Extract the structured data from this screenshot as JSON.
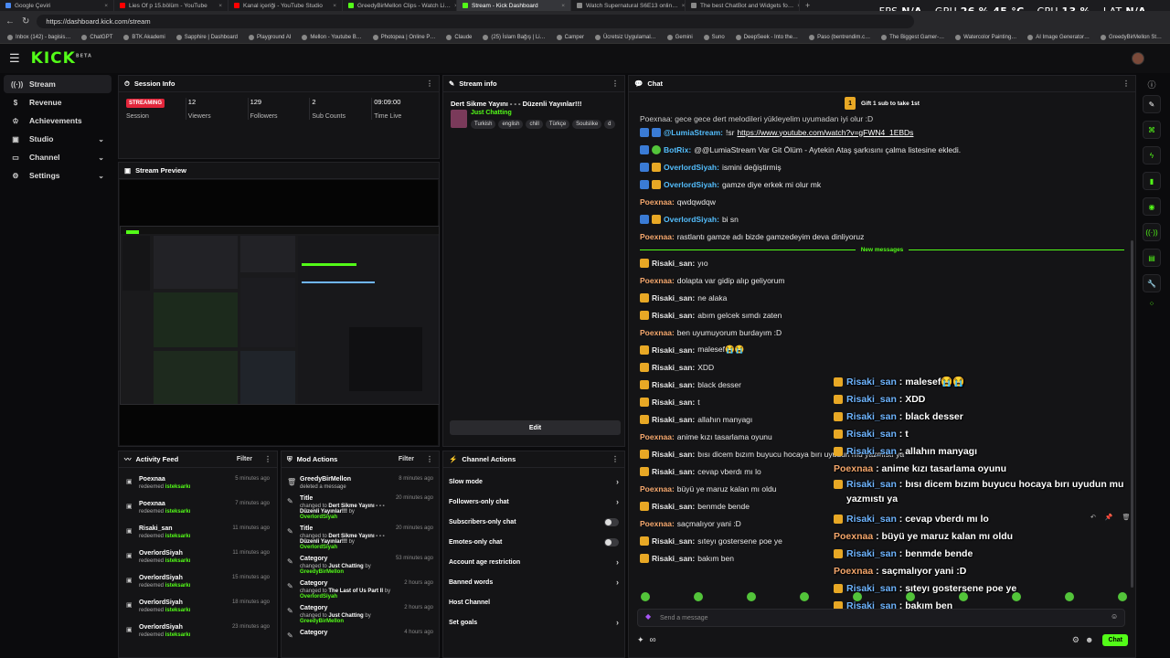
{
  "browser": {
    "tabs": [
      {
        "title": "Google Çeviri",
        "color": "#4a8af4"
      },
      {
        "title": "Lies Of p 15.bölüm - YouTube",
        "color": "#ff0000"
      },
      {
        "title": "Kanal içeriği - YouTube Studio",
        "color": "#ff0000"
      },
      {
        "title": "GreedyBirMellon Clips - Watch Li…",
        "color": "#53fc18"
      },
      {
        "title": "Stream - Kick Dashboard",
        "color": "#53fc18",
        "active": true
      },
      {
        "title": "Watch Supernatural S6E13 onlin…",
        "color": "#888888"
      },
      {
        "title": "The best ChatBot and Widgets fo…",
        "color": "#888888"
      }
    ],
    "url": "https://dashboard.kick.com/stream",
    "bookmarks": [
      "Inbox (142) - bagisis…",
      "ChatGPT",
      "BTK Akademi",
      "Sapphire | Dashboard",
      "Playground AI",
      "Mellon - Youtube B…",
      "Photopea | Online P…",
      "Claude",
      "(25) İslam Bağış | Li…",
      "Camper",
      "Ücretsiz Uygulamal…",
      "Gemini",
      "Suno",
      "DeepSeek - Into the…",
      "Paso (bentrendim.c…",
      "The Biggest Gamer-…",
      "Watercolor Painting…",
      "AI Image Generator…",
      "GreedyBirMellon St…"
    ]
  },
  "perf": {
    "fps_label": "FPS",
    "fps": "N/A",
    "gpu_label": "GPU",
    "gpu": "26 % 45 °C",
    "cpu_label": "CPU",
    "cpu": "13 %",
    "lat_label": "LAT",
    "lat": "N/A"
  },
  "sidebar": {
    "items": [
      {
        "label": "Stream",
        "icon": "broadcast-icon",
        "active": true
      },
      {
        "label": "Revenue",
        "icon": "dollar-icon"
      },
      {
        "label": "Achievements",
        "icon": "trophy-icon"
      },
      {
        "label": "Studio",
        "icon": "camera-icon",
        "expandable": true
      },
      {
        "label": "Channel",
        "icon": "channel-icon",
        "expandable": true
      },
      {
        "label": "Settings",
        "icon": "gear-icon",
        "expandable": true
      }
    ]
  },
  "session": {
    "title": "Session Info",
    "status": "STREAMING",
    "stats": [
      {
        "value": "",
        "label": "Session"
      },
      {
        "value": "12",
        "label": "Viewers"
      },
      {
        "value": "129",
        "label": "Followers"
      },
      {
        "value": "2",
        "label": "Sub Counts"
      },
      {
        "value": "09:09:00",
        "label": "Time Live"
      }
    ]
  },
  "preview": {
    "title": "Stream Preview"
  },
  "stream_info": {
    "title": "Stream info",
    "stream_title": "Dert Sikme Yayını - - - Düzenli Yayınlar!!!",
    "category": "Just Chatting",
    "tags": [
      "Turkish",
      "english",
      "chill",
      "Türkçe",
      "Soulslike",
      "d"
    ],
    "edit_label": "Edit"
  },
  "activity": {
    "title": "Activity Feed",
    "filter": "Filter",
    "rows": [
      {
        "who": "Poexnaa",
        "action": "redeemed",
        "item": "isteksarkı",
        "time": "5 minutes ago"
      },
      {
        "who": "Poexnaa",
        "action": "redeemed",
        "item": "isteksarkı",
        "time": "7 minutes ago"
      },
      {
        "who": "Risaki_san",
        "action": "redeemed",
        "item": "isteksarkı",
        "time": "11 minutes ago"
      },
      {
        "who": "OverlordSiyah",
        "action": "redeemed",
        "item": "isteksarkı",
        "time": "11 minutes ago"
      },
      {
        "who": "OverlordSiyah",
        "action": "redeemed",
        "item": "isteksarkı",
        "time": "15 minutes ago"
      },
      {
        "who": "OverlordSiyah",
        "action": "redeemed",
        "item": "isteksarkı",
        "time": "18 minutes ago"
      },
      {
        "who": "OverlordSiyah",
        "action": "redeemed",
        "item": "isteksarkı",
        "time": "23 minutes ago"
      }
    ]
  },
  "mod": {
    "title": "Mod Actions",
    "filter": "Filter",
    "rows": [
      {
        "head": "GreedyBirMellon",
        "line": "deleted a message",
        "time": "8 minutes ago"
      },
      {
        "head": "Title",
        "pre": "changed to",
        "bold": "Dert Sikme Yayını - - - Düzenli Yayınlar!!!",
        "by": "by",
        "user": "OverlordSiyah",
        "time": "20 minutes ago"
      },
      {
        "head": "Title",
        "pre": "changed to",
        "bold": "Dert Sikme Yayını - - - Düzenli Yayınlar!!!",
        "by": "by",
        "user": "OverlordSiyah",
        "time": "20 minutes ago"
      },
      {
        "head": "Category",
        "pre": "changed to",
        "bold": "Just Chatting",
        "by": "by",
        "user": "GreedyBirMellon",
        "time": "53 minutes ago"
      },
      {
        "head": "Category",
        "pre": "changed to",
        "bold": "The Last of Us Part II",
        "by": "by",
        "user": "OverlordSiyah",
        "time": "2 hours ago"
      },
      {
        "head": "Category",
        "pre": "changed to",
        "bold": "Just Chatting",
        "by": "by",
        "user": "GreedyBirMellon",
        "time": "2 hours ago"
      },
      {
        "head": "Category",
        "pre": "",
        "bold": "",
        "by": "",
        "user": "",
        "time": "4 hours ago"
      }
    ]
  },
  "channel_actions": {
    "title": "Channel Actions",
    "rows": [
      {
        "label": "Slow mode",
        "kind": "arrow"
      },
      {
        "label": "Followers-only chat",
        "kind": "arrow"
      },
      {
        "label": "Subscribers-only chat",
        "kind": "toggle"
      },
      {
        "label": "Emotes-only chat",
        "kind": "toggle"
      },
      {
        "label": "Account age restriction",
        "kind": "arrow"
      },
      {
        "label": "Banned words",
        "kind": "arrow"
      },
      {
        "label": "Host Channel",
        "kind": "none"
      },
      {
        "label": "Set goals",
        "kind": "arrow"
      }
    ]
  },
  "chat": {
    "title": "Chat",
    "gift_count": "1",
    "gift_text": "Gift 1 sub to take 1st",
    "top_partial": "Poexnaa: gece gece dert melodileri yükleyelim uyumadan iyi olur :D",
    "messages_before": [
      {
        "badges": [
          "blue",
          "blue"
        ],
        "name": "@LumiaStream:",
        "cls": "n2",
        "text": "!sr ",
        "link": "https://www.youtube.com/watch?v=gFWN4_1EBDs"
      },
      {
        "badges": [
          "blue",
          "green"
        ],
        "name": "BotRix:",
        "cls": "n2",
        "text": "@@LumiaStream Var Git Ölüm - Aytekin Ataş şarkısını çalma listesine ekledi."
      },
      {
        "badges": [
          "blue",
          "crown"
        ],
        "name": "OverlordSiyah:",
        "cls": "n2",
        "text": "ismini değiştirmiş"
      },
      {
        "badges": [
          "blue",
          "crown"
        ],
        "name": "OverlordSiyah:",
        "cls": "n2",
        "text": "gamze diye erkek mi olur mk"
      },
      {
        "badges": [],
        "name": "Poexnaa:",
        "cls": "n1",
        "text": "qwdqwdqw"
      },
      {
        "badges": [
          "blue",
          "crown"
        ],
        "name": "OverlordSiyah:",
        "cls": "n2",
        "text": "bi sn"
      },
      {
        "badges": [],
        "name": "Poexnaa:",
        "cls": "n1",
        "text": "rastlantı gamze adı bizde gamzedeyim deva dinliyoruz"
      }
    ],
    "new_messages_label": "New messages",
    "messages_after": [
      {
        "badges": [
          "crown"
        ],
        "name": "Risaki_san:",
        "cls": "n3",
        "text": "yıo"
      },
      {
        "badges": [],
        "name": "Poexnaa:",
        "cls": "n1",
        "text": "dolapta var gidip alıp geliyorum"
      },
      {
        "badges": [
          "crown"
        ],
        "name": "Risaki_san:",
        "cls": "n3",
        "text": "ne alaka"
      },
      {
        "badges": [
          "crown"
        ],
        "name": "Risaki_san:",
        "cls": "n3",
        "text": "abım gelcek sımdı zaten"
      },
      {
        "badges": [],
        "name": "Poexnaa:",
        "cls": "n1",
        "text": "ben uyumuyorum burdayım :D"
      },
      {
        "badges": [
          "crown"
        ],
        "name": "Risaki_san:",
        "cls": "n3",
        "text": "malesef😭😭"
      },
      {
        "badges": [
          "crown"
        ],
        "name": "Risaki_san:",
        "cls": "n3",
        "text": "XDD"
      },
      {
        "badges": [
          "crown"
        ],
        "name": "Risaki_san:",
        "cls": "n3",
        "text": "black desser"
      },
      {
        "badges": [
          "crown"
        ],
        "name": "Risaki_san:",
        "cls": "n3",
        "text": "t"
      },
      {
        "badges": [
          "crown"
        ],
        "name": "Risaki_san:",
        "cls": "n3",
        "text": "allahın manyagı"
      },
      {
        "badges": [],
        "name": "Poexnaa:",
        "cls": "n1",
        "text": "anime kızı tasarlama oyunu"
      },
      {
        "badges": [
          "crown"
        ],
        "name": "Risaki_san:",
        "cls": "n3",
        "text": "bısı dicem bızım buyucu hocaya bırı uyudun mu yazmıstı ya"
      },
      {
        "badges": [
          "crown"
        ],
        "name": "Risaki_san:",
        "cls": "n3",
        "text": "cevap vberdı mı lo"
      },
      {
        "badges": [],
        "name": "Poexnaa:",
        "cls": "n1",
        "text": "büyü ye maruz kalan mı oldu"
      },
      {
        "badges": [
          "crown"
        ],
        "name": "Risaki_san:",
        "cls": "n3",
        "text": "benmde bende"
      },
      {
        "badges": [],
        "name": "Poexnaa:",
        "cls": "n1",
        "text": "saçmalıyor yani :D"
      },
      {
        "badges": [
          "crown"
        ],
        "name": "Risaki_san:",
        "cls": "n3",
        "text": "sıteyı gostersene poe ye"
      },
      {
        "badges": [
          "crown"
        ],
        "name": "Risaki_san:",
        "cls": "n3",
        "text": "bakım ben"
      }
    ],
    "input_placeholder": "Send a message",
    "send_label": "Chat",
    "infinity": "∞"
  },
  "overlay": [
    {
      "name": "Risaki_san",
      "sep": " : ",
      "text": "malesef😭😭",
      "cls": "nm",
      "badge": true
    },
    {
      "name": "Risaki_san",
      "sep": " : ",
      "text": "XDD",
      "cls": "nm",
      "badge": true
    },
    {
      "name": "Risaki_san",
      "sep": " : ",
      "text": "black desser",
      "cls": "nm",
      "badge": true
    },
    {
      "name": "Risaki_san",
      "sep": " : ",
      "text": "t",
      "cls": "nm",
      "badge": true
    },
    {
      "name": "Risaki_san",
      "sep": " : ",
      "text": "allahın manyagı",
      "cls": "nm",
      "badge": true
    },
    {
      "name": "Poexnaa",
      "sep": " : ",
      "text": "anime kızı tasarlama oyunu",
      "cls": "nm2",
      "badge": false
    },
    {
      "name": "Risaki_san",
      "sep": " : ",
      "text": "bısı dicem bızım buyucu hocaya bırı uyudun mu yazmıstı ya",
      "cls": "nm",
      "badge": true,
      "wrap": true
    },
    {
      "name": "Risaki_san",
      "sep": " : ",
      "text": "cevap vberdı mı lo",
      "cls": "nm",
      "badge": true
    },
    {
      "name": "Poexnaa",
      "sep": " : ",
      "text": "büyü ye maruz kalan mı oldu",
      "cls": "nm2",
      "badge": false
    },
    {
      "name": "Risaki_san",
      "sep": " : ",
      "text": "benmde bende",
      "cls": "nm",
      "badge": true
    },
    {
      "name": "Poexnaa",
      "sep": " : ",
      "text": "saçmalıyor yani :D",
      "cls": "nm2",
      "badge": false
    },
    {
      "name": "Risaki_san",
      "sep": " : ",
      "text": "sıteyı gostersene poe ye",
      "cls": "nm",
      "badge": true
    },
    {
      "name": "Risaki_san",
      "sep": " : ",
      "text": "bakım ben",
      "cls": "nm",
      "badge": true
    }
  ],
  "colors": {
    "brand": "#53fc18",
    "live": "#e3263b",
    "bg": "#0b0b0d"
  }
}
